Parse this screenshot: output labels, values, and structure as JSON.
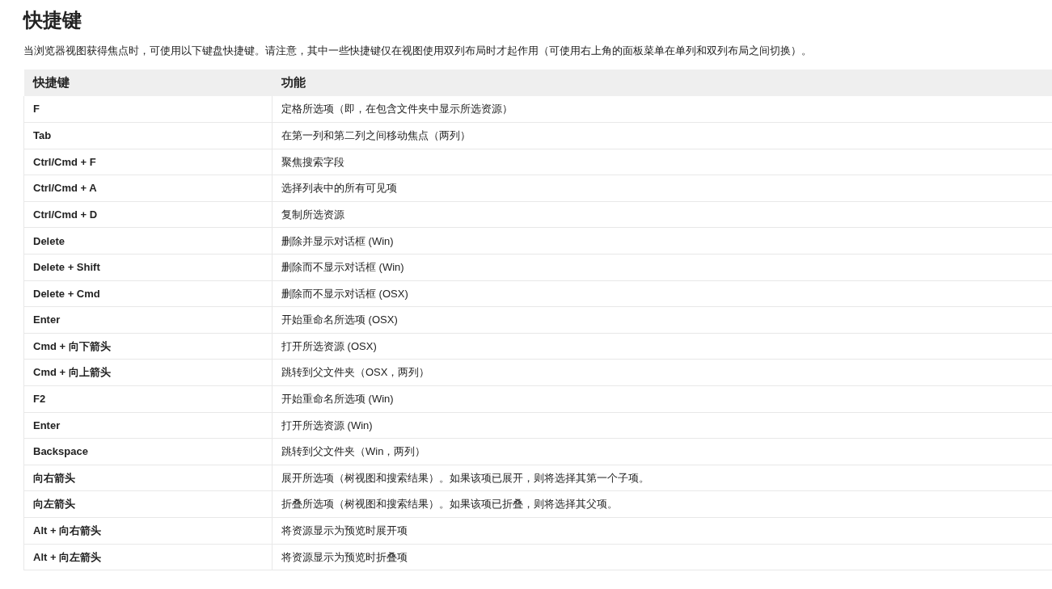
{
  "title": "快捷键",
  "intro": "当浏览器视图获得焦点时，可使用以下键盘快捷键。请注意，其中一些快捷键仅在视图使用双列布局时才起作用（可使用右上角的面板菜单在单列和双列布局之间切换）。",
  "table": {
    "columns": [
      "快捷键",
      "功能"
    ],
    "rows": [
      [
        "F",
        "定格所选项（即，在包含文件夹中显示所选资源）"
      ],
      [
        "Tab",
        "在第一列和第二列之间移动焦点（两列）"
      ],
      [
        "Ctrl/Cmd + F",
        "聚焦搜索字段"
      ],
      [
        "Ctrl/Cmd + A",
        "选择列表中的所有可见项"
      ],
      [
        "Ctrl/Cmd + D",
        "复制所选资源"
      ],
      [
        "Delete",
        "删除并显示对话框 (Win)"
      ],
      [
        "Delete + Shift",
        "删除而不显示对话框 (Win)"
      ],
      [
        "Delete + Cmd",
        "删除而不显示对话框 (OSX)"
      ],
      [
        "Enter",
        "开始重命名所选项 (OSX)"
      ],
      [
        "Cmd + 向下箭头",
        "打开所选资源 (OSX)"
      ],
      [
        "Cmd + 向上箭头",
        "跳转到父文件夹（OSX，两列）"
      ],
      [
        "F2",
        "开始重命名所选项 (Win)"
      ],
      [
        "Enter",
        "打开所选资源 (Win)"
      ],
      [
        "Backspace",
        "跳转到父文件夹（Win，两列）"
      ],
      [
        "向右箭头",
        "展开所选项（树视图和搜索结果）。如果该项已展开，则将选择其第一个子项。"
      ],
      [
        "向左箭头",
        "折叠所选项（树视图和搜索结果）。如果该项已折叠，则将选择其父项。"
      ],
      [
        "Alt + 向右箭头",
        "将资源显示为预览时展开项"
      ],
      [
        "Alt + 向左箭头",
        "将资源显示为预览时折叠项"
      ]
    ]
  }
}
